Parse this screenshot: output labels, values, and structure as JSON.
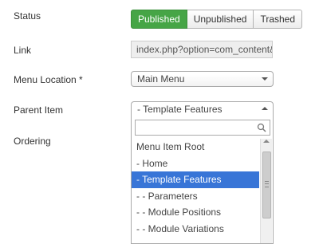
{
  "status": {
    "label": "Status",
    "options": [
      {
        "label": "Published",
        "active": true
      },
      {
        "label": "Unpublished",
        "active": false
      },
      {
        "label": "Trashed",
        "active": false
      }
    ],
    "active_color": "#46a546"
  },
  "link": {
    "label": "Link",
    "value": "index.php?option=com_content&view=article"
  },
  "menu_location": {
    "label": "Menu Location *",
    "selected": "Main Menu"
  },
  "parent_item": {
    "label": "Parent Item",
    "selected": "- Template Features",
    "search_placeholder": "",
    "options": [
      "Menu Item Root",
      "- Home",
      "- Template Features",
      "- - Parameters",
      "- - Module Positions",
      "- - Module Variations"
    ],
    "highlighted_index": 2,
    "highlight_color": "#3875d7"
  },
  "ordering": {
    "label": "Ordering"
  }
}
